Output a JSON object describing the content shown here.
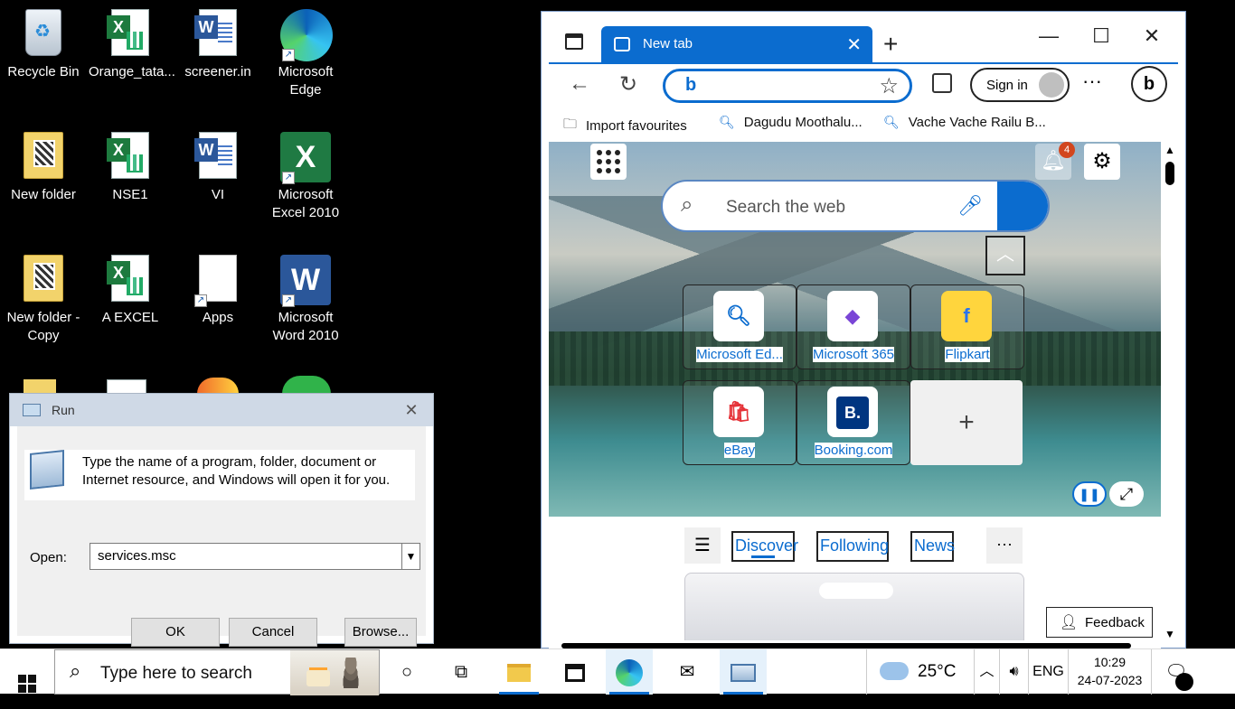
{
  "desktop": {
    "icons": [
      {
        "label": "Recycle Bin"
      },
      {
        "label": "Orange_tata..."
      },
      {
        "label": "screener.in"
      },
      {
        "label": "Microsoft Edge"
      },
      {
        "label": "New folder"
      },
      {
        "label": "NSE1"
      },
      {
        "label": "VI"
      },
      {
        "label": "Microsoft Excel 2010"
      },
      {
        "label": "New folder - Copy"
      },
      {
        "label": "A EXCEL"
      },
      {
        "label": "Apps"
      },
      {
        "label": "Microsoft Word 2010"
      }
    ]
  },
  "run_dialog": {
    "title": "Run",
    "close": "✕",
    "description": "Type the name of a program, folder, document or Internet resource, and Windows will open it for you.",
    "open_label": "Open:",
    "open_value": "services.msc",
    "buttons": {
      "ok": "OK",
      "cancel": "Cancel",
      "browse": "Browse..."
    }
  },
  "edge": {
    "tab_title": "New tab",
    "sign_in": "Sign in",
    "favourites": [
      {
        "label": "Import favourites"
      },
      {
        "label": "Dagudu Moothalu..."
      },
      {
        "label": "Vache Vache Railu B..."
      }
    ],
    "ntp": {
      "notification_count": "4",
      "search_placeholder": "Search the web",
      "tiles": [
        {
          "label": "Microsoft Ed...",
          "icon": "search-icon"
        },
        {
          "label": "Microsoft 365",
          "icon": "m365-icon"
        },
        {
          "label": "Flipkart",
          "icon": "flipkart-icon"
        },
        {
          "label": "eBay",
          "icon": "ebay-icon"
        },
        {
          "label": "Booking.com",
          "icon": "booking-icon"
        }
      ]
    },
    "feed": {
      "tabs": [
        "Discover",
        "Following",
        "News"
      ],
      "feedback": "Feedback"
    }
  },
  "taskbar": {
    "search_placeholder": "Type here to search",
    "weather": "25°C",
    "language": "ENG",
    "time": "10:29",
    "date": "24-07-2023"
  },
  "colors": {
    "accent": "#0b6ccf",
    "excel": "#1d7a3e",
    "word": "#2b579a"
  }
}
